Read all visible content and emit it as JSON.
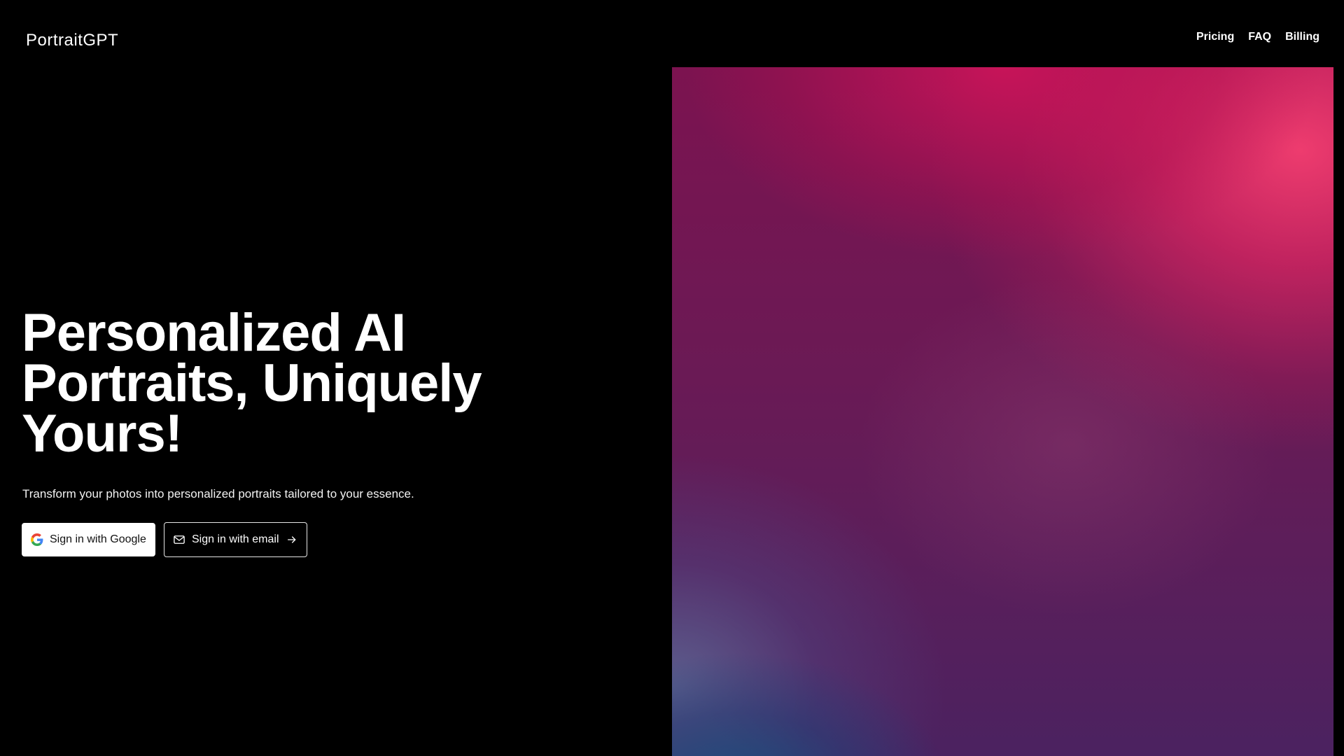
{
  "app": {
    "logo_text": "PortraitGPT"
  },
  "nav": {
    "items": [
      {
        "label": "Pricing"
      },
      {
        "label": "FAQ"
      },
      {
        "label": "Billing"
      }
    ]
  },
  "hero": {
    "headline_line1": "Personalized AI",
    "headline_line2": "Portraits, Uniquely",
    "headline_line3": "Yours!",
    "subheading": "Transform your photos into personalized portraits tailored to your essence.",
    "google_button_label": "Sign in with Google",
    "email_button_label": "Sign in with email"
  },
  "icons": {
    "google": "google-logo-icon",
    "mail": "mail-icon",
    "arrow": "arrow-right-icon"
  },
  "colors": {
    "background": "#000000",
    "text": "#ffffff",
    "gradient_pink": "#e8235f",
    "gradient_magenta": "#8a1557",
    "gradient_purple": "#5a2466",
    "gradient_blue": "#1f4f7a"
  }
}
